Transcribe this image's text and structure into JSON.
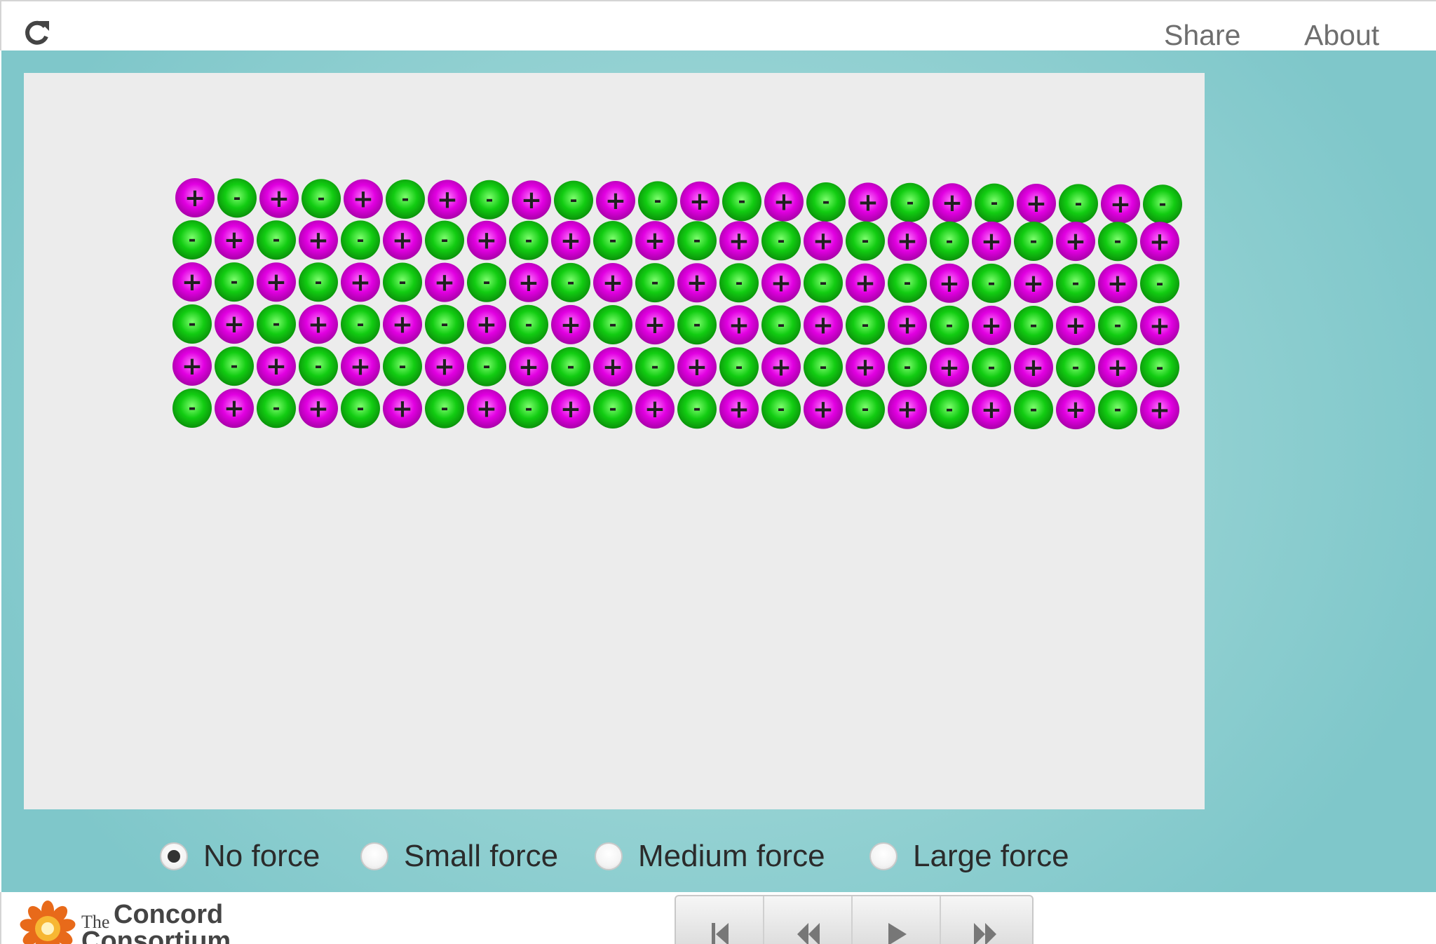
{
  "topbar": {
    "reload_icon": "reload-icon",
    "share_label": "Share",
    "about_label": "About"
  },
  "model": {
    "particle_colors": {
      "positive": "#e600e6",
      "negative": "#12cc12"
    },
    "signs": {
      "positive": "+",
      "negative": "-"
    },
    "lattice": {
      "rows": 6,
      "columns": 24,
      "first_row_starts_with": "positive",
      "alternating": true
    }
  },
  "force_controls": {
    "options": [
      {
        "label": "No force",
        "selected": true
      },
      {
        "label": "Small force",
        "selected": false
      },
      {
        "label": "Medium force",
        "selected": false
      },
      {
        "label": "Large force",
        "selected": false
      }
    ]
  },
  "footer": {
    "logo_the": "The",
    "logo_name": "Concord",
    "logo_sub": "Consortium",
    "playback": [
      "reset-icon",
      "step-back-icon",
      "play-icon",
      "step-forward-icon"
    ]
  },
  "colors": {
    "teal_background": "#8fd0d2",
    "panel_background": "#ececec"
  }
}
